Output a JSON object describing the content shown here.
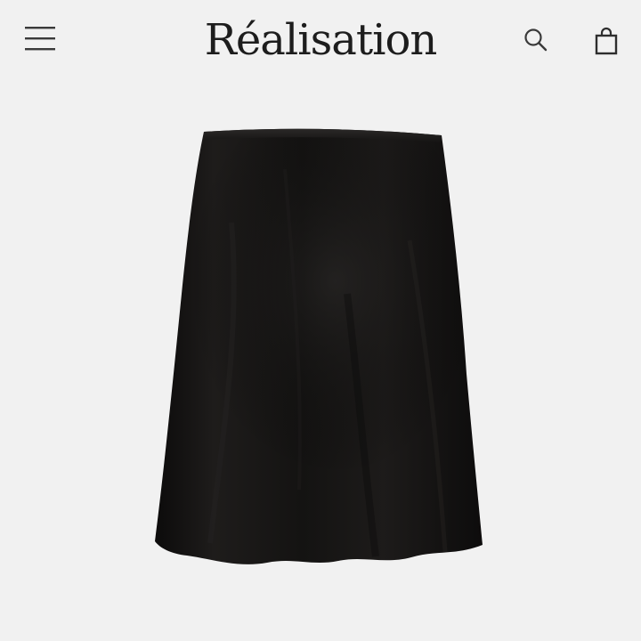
{
  "header": {
    "brand": "Réalisation",
    "icons": {
      "menu": "hamburger-menu-icon",
      "search": "search-icon",
      "bag": "shopping-bag-icon"
    }
  },
  "product": {
    "image": "black-satin-mini-skirt",
    "color": "#161413"
  },
  "colors": {
    "background": "#f1f1f1",
    "text": "#1d1d1d"
  }
}
